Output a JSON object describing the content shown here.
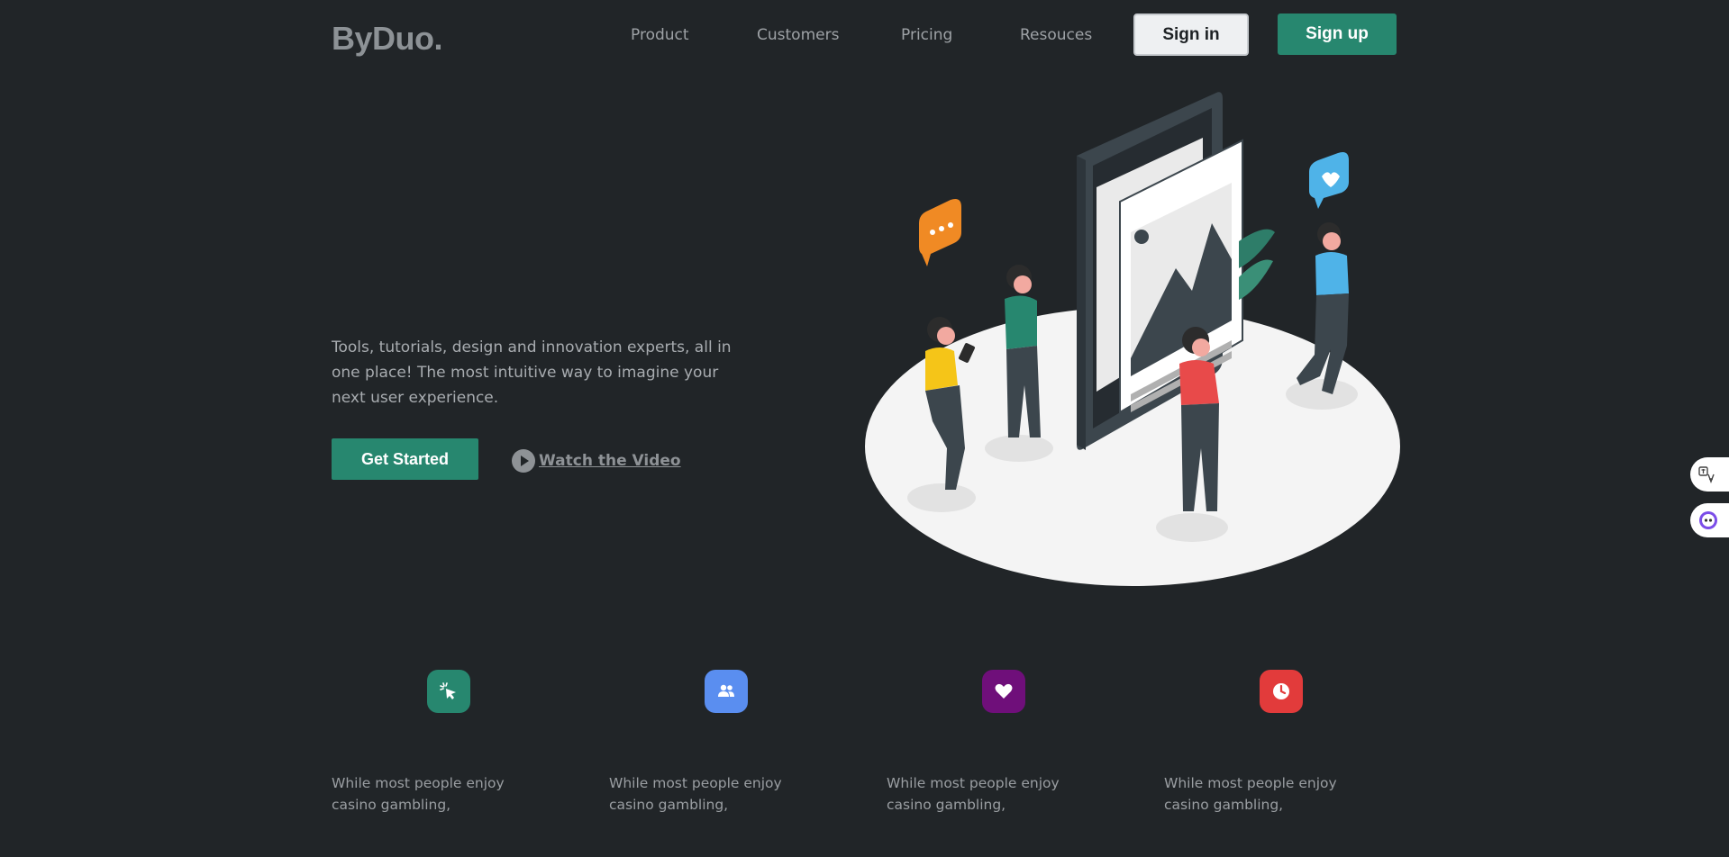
{
  "brand": {
    "logo": "ByDuo."
  },
  "nav": {
    "items": [
      "Product",
      "Customers",
      "Pricing",
      "Resouces"
    ],
    "signin_label": "Sign in",
    "signup_label": "Sign up"
  },
  "hero": {
    "description": "Tools, tutorials, design and innovation experts, all in one place! The most intuitive way to imagine your next user experience.",
    "cta_label": "Get Started",
    "video_label": "Watch the Video"
  },
  "features": [
    {
      "icon": "cursor-click-icon",
      "color": "#27876f",
      "text": "While most people enjoy casino gambling,"
    },
    {
      "icon": "users-icon",
      "color": "#5a8ef0",
      "text": "While most people enjoy casino gambling,"
    },
    {
      "icon": "heart-icon",
      "color": "#6f0f7a",
      "text": "While most people enjoy casino gambling,"
    },
    {
      "icon": "clock-icon",
      "color": "#e23b3b",
      "text": "While most people enjoy casino gambling,"
    }
  ],
  "colors": {
    "background": "#212528",
    "accent": "#27876f"
  }
}
